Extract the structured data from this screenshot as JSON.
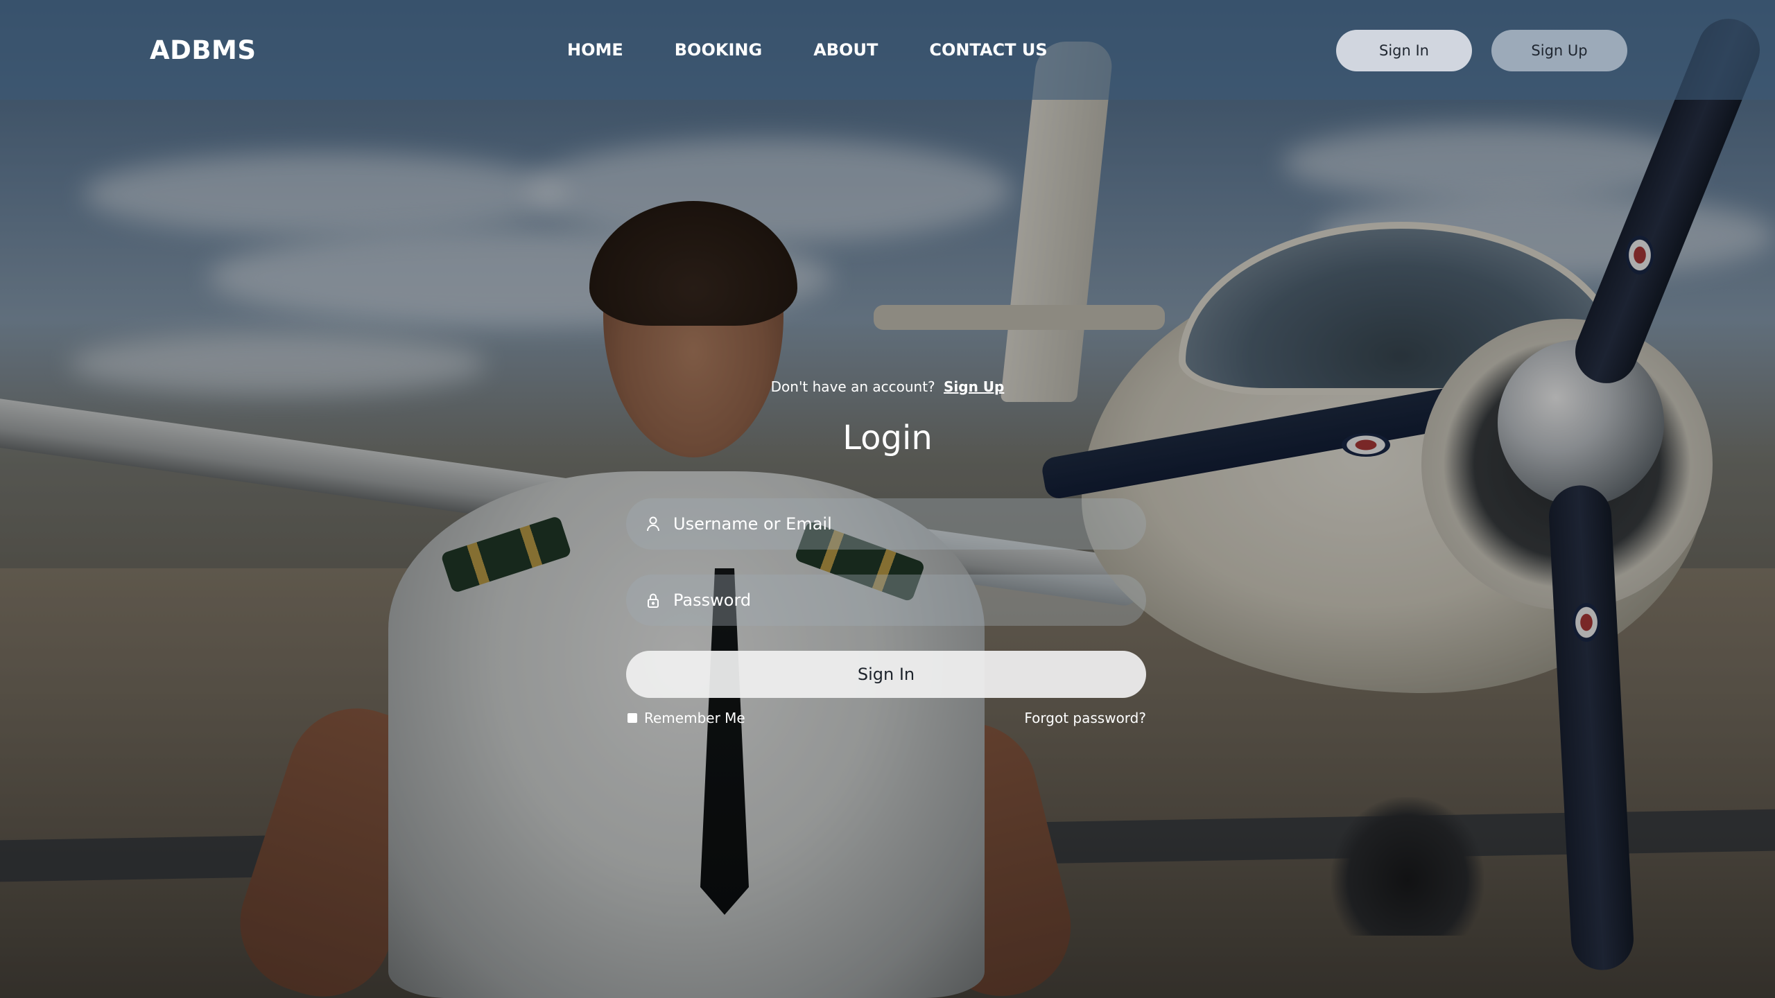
{
  "header": {
    "logo": "ADBMS",
    "nav": [
      {
        "label": "HOME"
      },
      {
        "label": "BOOKING"
      },
      {
        "label": "ABOUT"
      },
      {
        "label": "CONTACT US"
      }
    ],
    "signin_label": "Sign In",
    "signup_label": "Sign Up"
  },
  "form": {
    "signup_prompt": "Don't have an account?",
    "signup_link": "Sign Up",
    "title": "Login",
    "username_placeholder": "Username or Email",
    "password_placeholder": "Password",
    "submit_label": "Sign In",
    "remember_label": "Remember Me",
    "forgot_label": "Forgot password?"
  },
  "icons": {
    "username": "user-icon",
    "password": "lock-icon"
  },
  "colors": {
    "header_bg": "#3c5876",
    "button_light": "#dee2e8",
    "button_muted": "#aab6c4",
    "text": "#ffffff"
  }
}
